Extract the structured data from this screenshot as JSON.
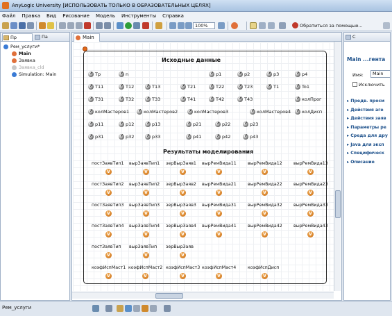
{
  "window": {
    "title": "AnyLogic University [ИСПОЛЬЗОВАТЬ ТОЛЬКО В ОБРАЗОВАТЕЛЬНЫХ ЦЕЛЯХ]"
  },
  "menu": [
    "Файл",
    "Правка",
    "Вид",
    "Рисование",
    "Модель",
    "Инструменты",
    "Справка"
  ],
  "toolbar": {
    "zoom": "100%",
    "help_label": "Обратиться за помощью..."
  },
  "left_panel": {
    "tab1": "Пр",
    "tab2": "Па",
    "tree": [
      {
        "label": "Рем_услуги*",
        "color": "#3a7bd5"
      },
      {
        "label": "Main",
        "color": "#e0703a",
        "bold": true
      },
      {
        "label": "Заявка",
        "color": "#e0703a"
      },
      {
        "label": "Заявка_cld",
        "color": "#c8c8c8",
        "grey": true
      },
      {
        "label": "Simulation: Main",
        "color": "#3a7bd5"
      }
    ]
  },
  "editor": {
    "tab": "Main",
    "section1": "Исходные данные",
    "section2": "Результаты моделирования",
    "params": [
      "Tp",
      "n",
      "p1",
      "p2",
      "p3",
      "p4",
      "T11",
      "T12",
      "T13",
      "T21",
      "T22",
      "T23",
      "T1",
      "To1",
      "T31",
      "T32",
      "T33",
      "T41",
      "T42",
      "T43",
      "колПрог",
      "колМастеров1",
      "колМастеров2",
      "колМастеров3",
      "колМастеров4",
      "колДисп",
      "p11",
      "p12",
      "p13",
      "p21",
      "p22",
      "p23",
      "p31",
      "p32",
      "p33",
      "p41",
      "p42",
      "p43"
    ],
    "results": [
      "постЗаявТип1",
      "вырЗаявТип1",
      "зерВырЗаяв1",
      "вырРемВида11",
      "вырРемВида12",
      "вырРемВида13",
      "постЗаявТип2",
      "вырЗаявТип2",
      "зерВырЗаяв2",
      "вырРемВида21",
      "вырРемВида22",
      "вырРемВида23",
      "постЗаявТип3",
      "вырЗаявТип3",
      "зерВырЗаяв3",
      "вырРемВида31",
      "вырРемВида32",
      "вырРемВида33",
      "постЗаявТип4",
      "вырЗаявТип4",
      "зерВырЗаяв4",
      "вырРемВида41",
      "вырРемВида42",
      "вырРемВида43",
      "постЗаявТип",
      "вырЗаявТип",
      "зерВырЗаяв",
      "коэфИспМаст1",
      "коэфИспМаст2",
      "коэфИспМаст3",
      "коэфИспМаст4",
      "коэфИспДисп"
    ],
    "badge_letter": "V"
  },
  "right_panel": {
    "tab": "С",
    "title": "Main ...гента",
    "name_label": "Имя:",
    "name_value": "Main",
    "exclude_label": "Исключить",
    "sections": [
      "Предв. просм",
      "Действия аге",
      "Действия заяв",
      "Параметры ре",
      "Среда для дру",
      "Java для эксп",
      "Специфическ",
      "Описание"
    ]
  },
  "status": {
    "text": "Рем_услуги"
  }
}
